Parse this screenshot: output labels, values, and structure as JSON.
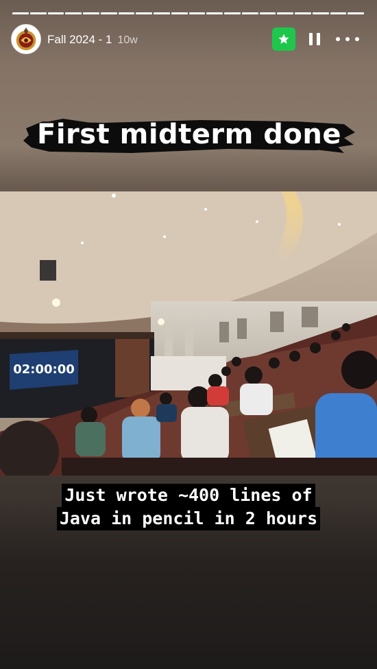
{
  "story": {
    "title": "Fall 2024 - 1",
    "age": "10w",
    "progress_segments": 20,
    "progress_filled": 20
  },
  "header": {
    "avatar_icon": "college-logo-avatar",
    "close_friends_icon": "star-icon",
    "close_friends_color": "#1ec74b",
    "pause_icon": "pause-icon",
    "more_icon": "more-options-icon"
  },
  "sticker": {
    "text": "First midterm done"
  },
  "photo": {
    "screen_timer": "02:00:00"
  },
  "caption": {
    "line1": "Just wrote ~400 lines of",
    "line2": "Java in pencil in 2 hours"
  }
}
